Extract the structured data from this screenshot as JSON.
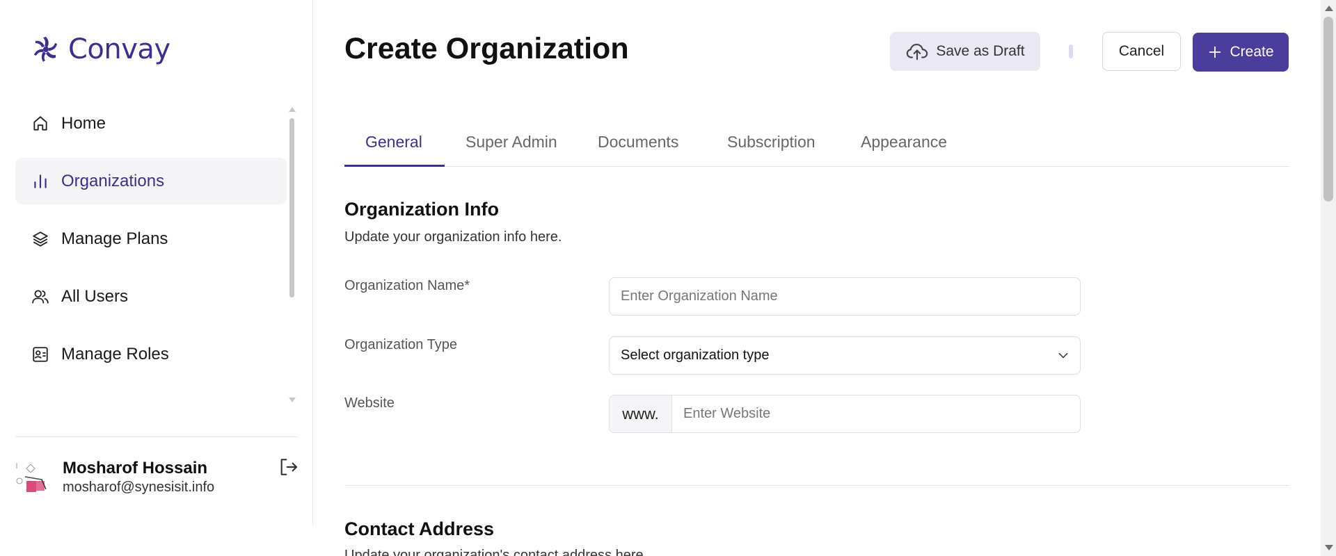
{
  "brand": {
    "name": "Convay",
    "accent": "#3b2f8f"
  },
  "sidebar": {
    "items": [
      {
        "label": "Home",
        "icon": "home-icon",
        "active": false
      },
      {
        "label": "Organizations",
        "icon": "bar-chart-icon",
        "active": true
      },
      {
        "label": "Manage Plans",
        "icon": "layers-icon",
        "active": false
      },
      {
        "label": "All Users",
        "icon": "users-icon",
        "active": false
      },
      {
        "label": "Manage Roles",
        "icon": "id-badge-icon",
        "active": false
      }
    ],
    "user": {
      "name": "Mosharof Hossain",
      "email": "mosharof@synesisit.info"
    }
  },
  "header": {
    "title": "Create Organization",
    "save_draft_label": "Save as Draft",
    "cancel_label": "Cancel",
    "create_label": "Create"
  },
  "tabs": [
    {
      "label": "General",
      "active": true
    },
    {
      "label": "Super Admin",
      "active": false
    },
    {
      "label": "Documents",
      "active": false
    },
    {
      "label": "Subscription",
      "active": false
    },
    {
      "label": "Appearance",
      "active": false
    }
  ],
  "org_info": {
    "title": "Organization Info",
    "subtitle": "Update your organization info here.",
    "name_label": "Organization Name*",
    "name_placeholder": "Enter Organization Name",
    "type_label": "Organization Type",
    "type_value": "Select organization type",
    "website_label": "Website",
    "website_prefix": "www.",
    "website_placeholder": "Enter Website"
  },
  "contact": {
    "title": "Contact Address",
    "subtitle": "Update your organization's contact address here."
  }
}
